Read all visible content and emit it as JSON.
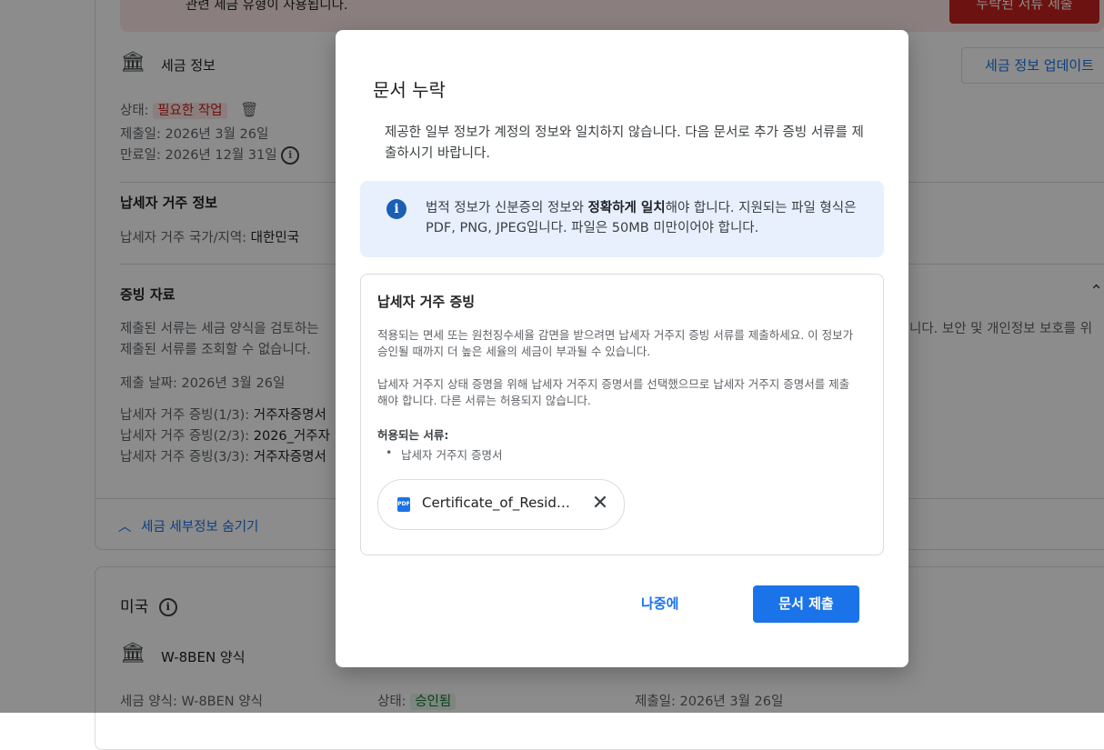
{
  "background": {
    "banner_text": "관련 세금 유형이 사용됩니다.",
    "banner_button": "누락된 서류 제출",
    "tax_info_title": "세금 정보",
    "update_button": "세금 정보 업데이트",
    "status_label": "상태:",
    "status_value": "필요한 작업",
    "submitted_date": "제출일: 2026년 3월 26일",
    "expiry_date": "만료일: 2026년 12월 31일",
    "residence_title": "납세자 거주 정보",
    "residence_country_label": "납세자 거주 국가/지역:",
    "residence_country_value": "대한민국",
    "evidence_title": "증빙 자료",
    "evidence_desc_1": "제출된 서류는 세금 양식을 검토하는",
    "evidence_desc_right": "니다. 보안 및 개인정보 보호를 위",
    "evidence_desc_2": "제출된 서류를 조회할 수 없습니다.",
    "submit_date": "제출 날짜: 2026년 3월 26일",
    "evidence_1_label": "납세자 거주 증빙(1/3):",
    "evidence_1_value": "거주자증명서",
    "evidence_2_label": "납세자 거주 증빙(2/3):",
    "evidence_2_value": "2026_거주자",
    "evidence_3_label": "납세자 거주 증빙(3/3):",
    "evidence_3_value": "거주자증명서",
    "hide_details": "세금 세부정보 숨기기",
    "us_title": "미국",
    "w8ben_title": "W-8BEN 양식",
    "form_label": "세금 양식: W-8BEN 양식",
    "us_status_label": "상태:",
    "us_status_value": "승인됨",
    "us_submitted": "제출일: 2026년 3월 26일"
  },
  "modal": {
    "title": "문서 누락",
    "description": "제공한 일부 정보가 계정의 정보와 일치하지 않습니다. 다음 문서로 추가 증빙 서류를 제출하시기 바랍니다.",
    "info": {
      "pre": "법적 정보가 신분증의 정보와 ",
      "bold": "정확하게 일치",
      "post": "해야 합니다. 지원되는 파일 형식은 PDF, PNG, JPEG입니다. 파일은 50MB 미만이어야 합니다."
    },
    "doc": {
      "title": "납세자 거주 증빙",
      "para1": "적용되는 면세 또는 원천징수세율 감면을 받으려면 납세자 거주지 증빙 서류를 제출하세요. 이 정보가 승인될 때까지 더 높은 세율의 세금이 부과될 수 있습니다.",
      "para2": "납세자 거주지 상태 증명을 위해 납세자 거주지 증명서를 선택했으므로 납세자 거주지 증명서를 제출해야 합니다. 다른 서류는 허용되지 않습니다.",
      "allowed_label": "허용되는 서류:",
      "allowed_items": [
        "납세자 거주지 증명서"
      ],
      "file_name": "Certificate_of_Reside…",
      "file_type": "PDF"
    },
    "later_button": "나중에",
    "submit_button": "문서 제출"
  },
  "colors": {
    "primary": "#1a73e8",
    "overlay": "rgba(0,0,0,0.45)",
    "info_bg": "#e8f0fe",
    "danger": "#c5221f",
    "success": "#137333"
  }
}
